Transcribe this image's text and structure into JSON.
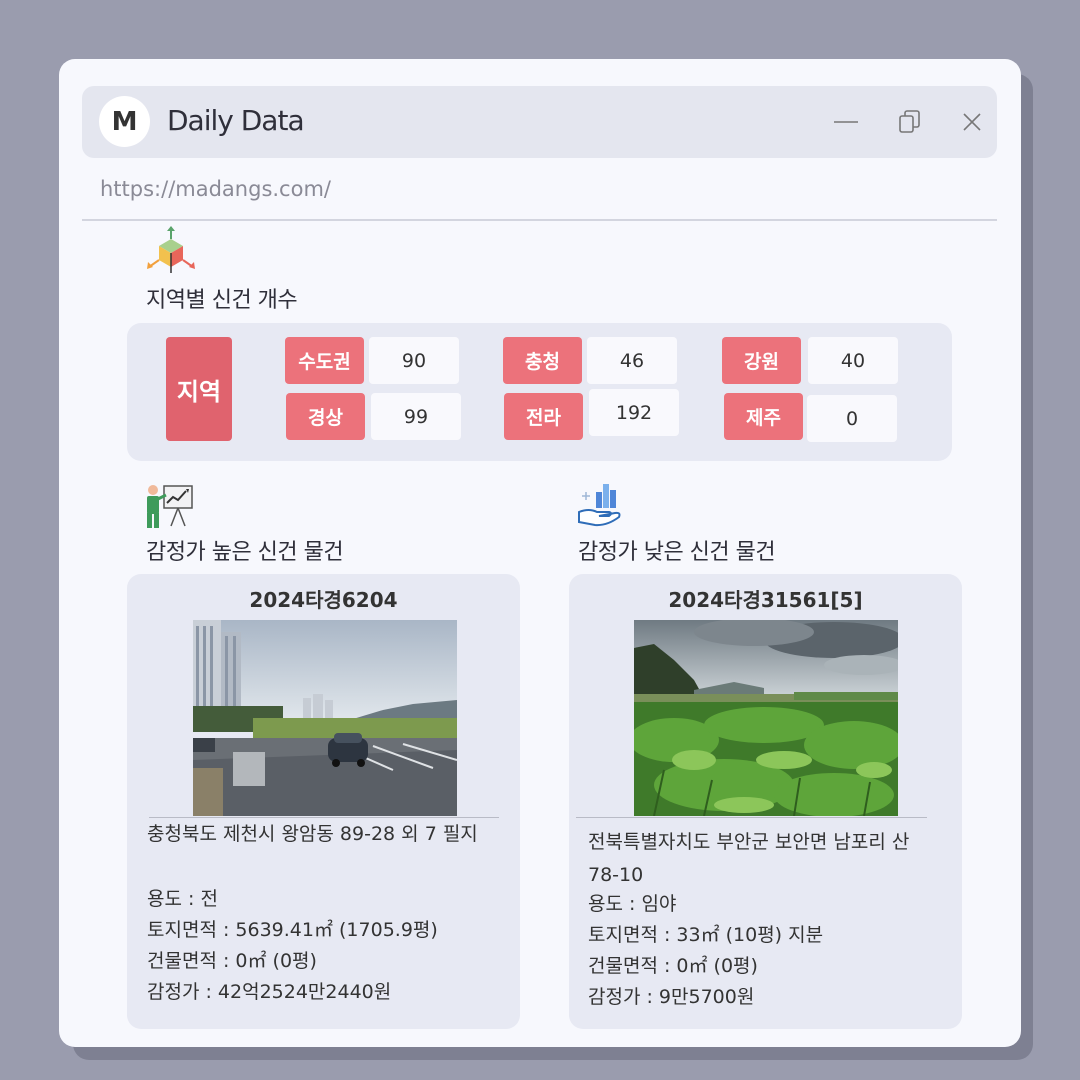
{
  "window": {
    "logo_letter": "M",
    "title": "Daily Data",
    "url": "https://madangs.com/"
  },
  "icons": {
    "minimize": "minimize-icon",
    "restore": "copy-window-icon",
    "close": "close-icon",
    "region_section": "3d-cube-axes-icon",
    "high_section": "presenter-chart-icon",
    "low_section": "hand-bar-chart-icon"
  },
  "regions": {
    "section_title": "지역별 신건 개수",
    "main_label": "지역",
    "items": [
      {
        "label": "수도권",
        "value": "90"
      },
      {
        "label": "충청",
        "value": "46"
      },
      {
        "label": "강원",
        "value": "40"
      },
      {
        "label": "경상",
        "value": "99"
      },
      {
        "label": "전라",
        "value": "192"
      },
      {
        "label": "제주",
        "value": "0"
      }
    ]
  },
  "high": {
    "section_title": "감정가 높은 신건 물건",
    "case_no": "2024타경6204",
    "address": "충청북도 제천시 왕암동 89-28 외 7 필지",
    "use": "용도 : 전",
    "land_area": "토지면적 : 5639.41㎡ (1705.9평)",
    "building_area": "건물면적 : 0㎡ (0평)",
    "appraisal": "감정가 : 42억2524만2440원"
  },
  "low": {
    "section_title": "감정가 낮은 신건 물건",
    "case_no": "2024타경31561[5]",
    "address_line1": "전북특별자치도 부안군 보안면 남포리 산",
    "address_line2": "78-10",
    "use": "용도 : 임야",
    "land_area": "토지면적 : 33㎡ (10평) 지분",
    "building_area": "건물면적 : 0㎡ (0평)",
    "appraisal": "감정가 : 9만5700원"
  },
  "colors": {
    "background": "#9a9cae",
    "window": "#f7f8fd",
    "region_main": "#e0636e",
    "region_label": "#ec727b",
    "panel": "#e7e9f3"
  }
}
